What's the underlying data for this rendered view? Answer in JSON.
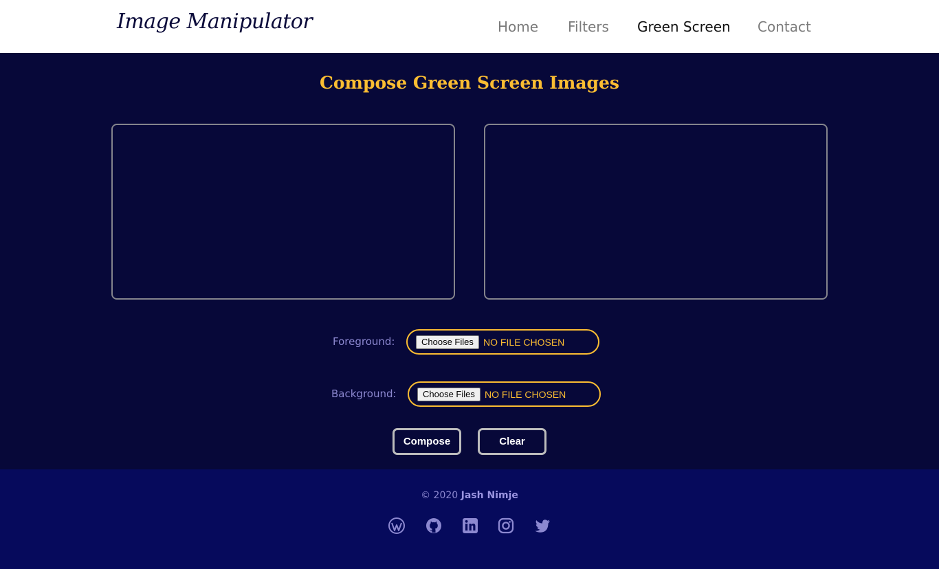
{
  "brand": {
    "logo_text": "Image Manipulator"
  },
  "nav": {
    "items": [
      {
        "label": "Home",
        "active": false
      },
      {
        "label": "Filters",
        "active": false
      },
      {
        "label": "Green Screen",
        "active": true
      },
      {
        "label": "Contact",
        "active": false
      }
    ]
  },
  "main": {
    "title": "Compose Green Screen Images",
    "foreground": {
      "label": "Foreground:",
      "button_label": "Choose Files",
      "status": "NO FILE CHOSEN"
    },
    "background": {
      "label": "Background:",
      "button_label": "Choose Files",
      "status": "NO FILE CHOSEN"
    },
    "compose_label": "Compose",
    "clear_label": "Clear"
  },
  "footer": {
    "copyright": "© 2020",
    "author": "Jash Nimje",
    "social": [
      "wordpress-icon",
      "github-icon",
      "linkedin-icon",
      "instagram-icon",
      "twitter-icon"
    ]
  },
  "colors": {
    "accent": "#fbbd32",
    "page_background": "#070839",
    "footer_background": "#060a5c",
    "muted_text": "#8c88d0"
  }
}
